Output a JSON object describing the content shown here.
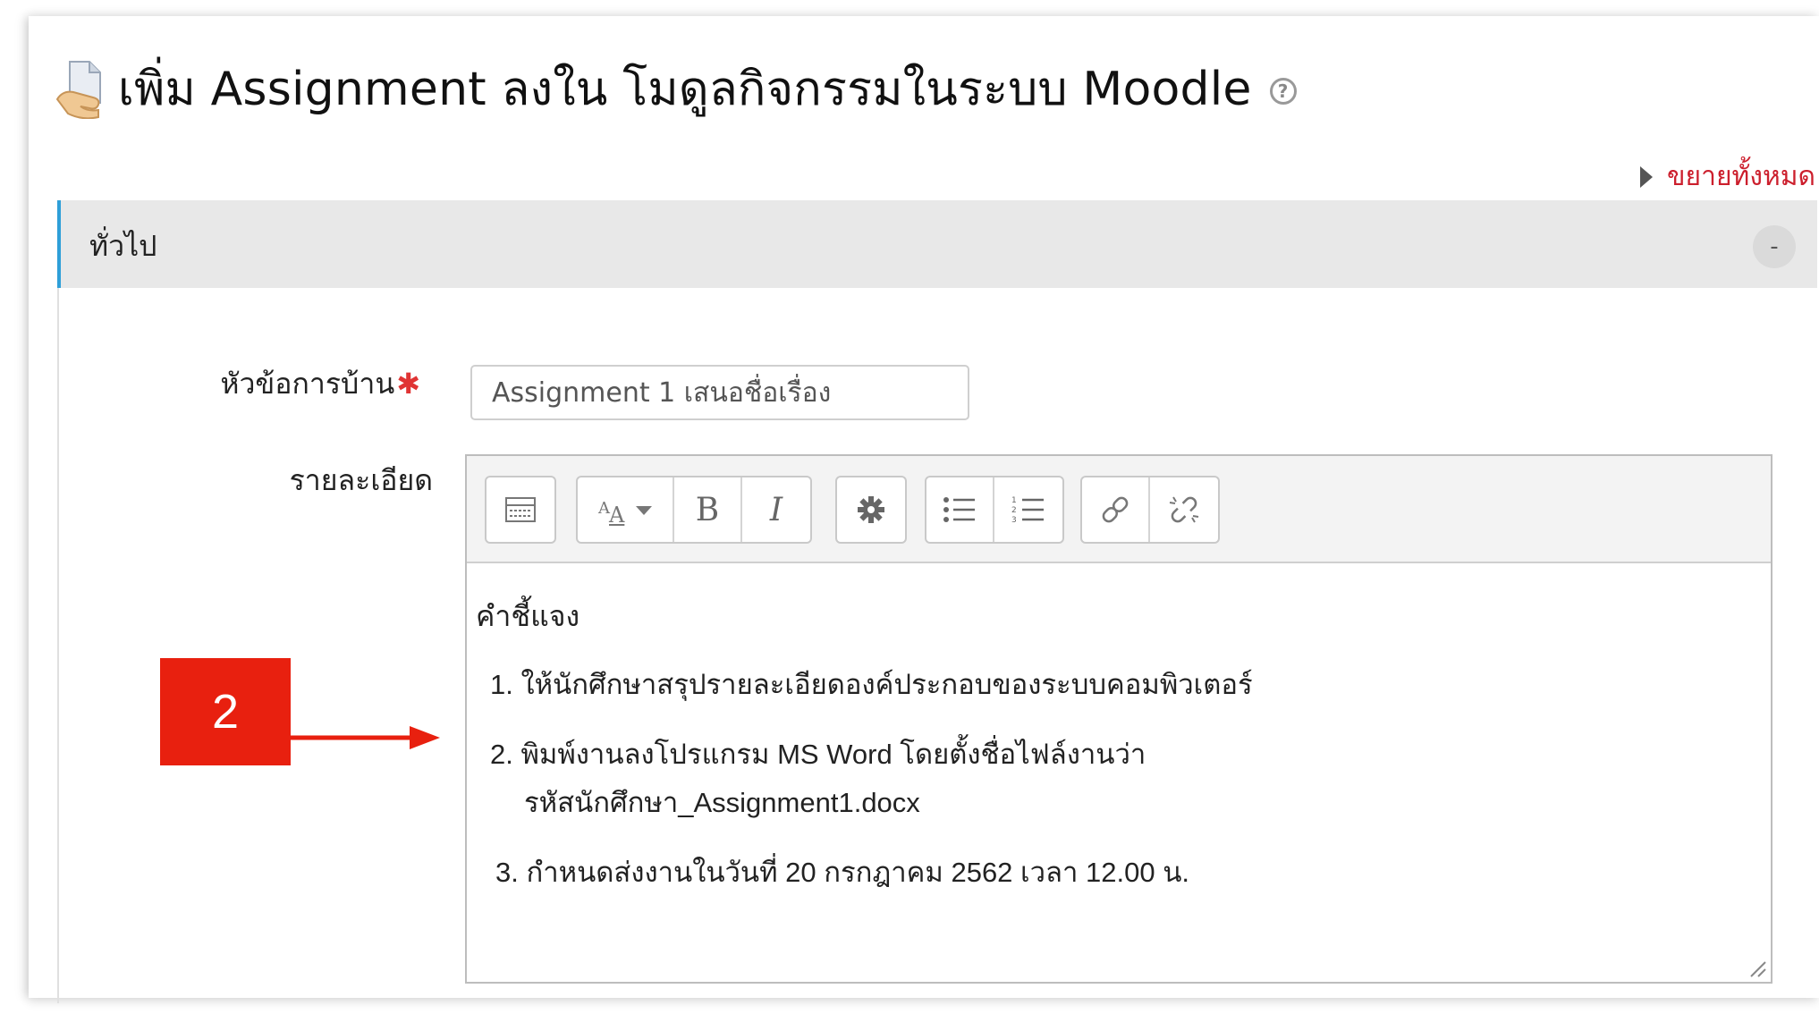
{
  "page_title": "เพิ่ม Assignment ลงใน โมดูลกิจกรรมในระบบ Moodle",
  "expand_all": "ขยายทั้งหมด",
  "section": {
    "title": "ทั่วไป",
    "collapse_symbol": "-"
  },
  "form": {
    "name_label": "หัวข้อการบ้าน",
    "required_marker": "✱",
    "name_value": "Assignment 1 เสนอชื่อเรื่อง",
    "description_label": "รายละเอียด"
  },
  "toolbar": {
    "bold": "B",
    "italic": "I",
    "icons": [
      "toggle-toolbar-icon",
      "font-style-icon",
      "bold-icon",
      "italic-icon",
      "settings-gear-icon",
      "unordered-list-icon",
      "ordered-list-icon",
      "link-icon",
      "unlink-icon"
    ]
  },
  "editor": {
    "heading": "คำชี้แจง",
    "items": [
      "1.  ให้นักศึกษาสรุปรายละเอียดองค์ประกอบของระบบคอมพิวเตอร์",
      "2. พิมพ์งานลงโปรแกรม  MS Word โดยตั้งชื่อไฟล์งานว่า",
      "รหัสนักศึกษา_Assignment1.docx",
      "3. กำหนดส่งงานในวันที่ 20 กรกฎาคม 2562 เวลา 12.00 น."
    ]
  },
  "annotation": {
    "step_number": "2",
    "color": "#e8200f"
  },
  "colors": {
    "accent_blue": "#2f9fd8",
    "link_red": "#cc1f2d",
    "required_red": "#e03434"
  }
}
